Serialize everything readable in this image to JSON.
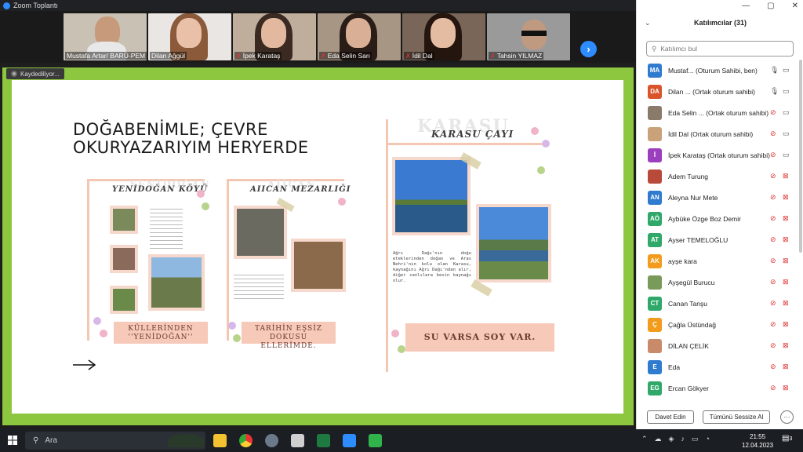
{
  "window": {
    "title": "Zoom Toplantı"
  },
  "participants_strip": [
    {
      "name": "Mustafa Artar/ BARÜ-PEM",
      "muted": false
    },
    {
      "name": "Dilan Ağgül",
      "muted": false
    },
    {
      "name": "İpek Karataş",
      "muted": true
    },
    {
      "name": "Eda Selin Sarı",
      "muted": true
    },
    {
      "name": "İdil Dal",
      "muted": true
    },
    {
      "name": "Tahsin YILMAZ",
      "muted": true
    }
  ],
  "recording": {
    "label": "Kaydediliyor..."
  },
  "slide": {
    "title_line1": "DOĞABENİMLE; ÇEVRE",
    "title_line2": "OKURYAZARIYIM HERYERDE",
    "sections": [
      {
        "ghost": "YENİDOĞAN",
        "title": "YENİDOĞAN KÖYÜ",
        "caption": "KÜLLERİNDEN ''YENİDOĞAN''"
      },
      {
        "ghost": "AİİCAN",
        "title": "AIICAN MEZARLIĞI",
        "caption": "TARİHİN EŞSİZ DOKUSU ELLERİMDE."
      },
      {
        "ghost": "KARASU",
        "title": "KARASU ÇAYI",
        "caption": "SU VARSA SOY VAR."
      }
    ],
    "karasu_text": "Ağrı Dağı'nın doğu eteklerinden doğan ve Aras Nehri'nin kolu olan Karasu, kaynağını Ağrı Dağı'ndan alır, diğer canlılara besin kaynağı olur."
  },
  "panel": {
    "title": "Katılımcılar (31)",
    "search_placeholder": "Katılımcı bul",
    "participants": [
      {
        "initials": "MA",
        "color": "#2e7bcf",
        "name": "Mustaf...  (Oturum Sahibi, ben)",
        "mic": "on",
        "cam": "off"
      },
      {
        "initials": "DA",
        "color": "#d9542b",
        "name": "Dilan ...  (Ortak oturum sahibi)",
        "mic": "on",
        "cam": "off"
      },
      {
        "initials": "",
        "color": "#8a7a6a",
        "name": "Eda Selin ...  (Ortak oturum sahibi)",
        "mic": "muted",
        "cam": "off"
      },
      {
        "initials": "",
        "color": "#c9a27a",
        "name": "İdil Dal  (Ortak oturum sahibi)",
        "mic": "muted",
        "cam": "off"
      },
      {
        "initials": "İ",
        "color": "#9b3fbf",
        "name": "İpek Karataş  (Ortak oturum sahibi)",
        "mic": "muted",
        "cam": "off"
      },
      {
        "initials": "",
        "color": "#b84a3a",
        "name": "Adem Turung",
        "mic": "muted",
        "cam": "muted"
      },
      {
        "initials": "AN",
        "color": "#2e7bcf",
        "name": "Aleyna Nur Mete",
        "mic": "muted",
        "cam": "muted"
      },
      {
        "initials": "AÖ",
        "color": "#2fa86a",
        "name": "Aybüke Özge Boz Demir",
        "mic": "muted",
        "cam": "muted"
      },
      {
        "initials": "AT",
        "color": "#2fa86a",
        "name": "Ayser TEMELOĞLU",
        "mic": "muted",
        "cam": "muted"
      },
      {
        "initials": "AK",
        "color": "#f29b1d",
        "name": "ayşe kara",
        "mic": "muted",
        "cam": "muted"
      },
      {
        "initials": "",
        "color": "#7a9a5a",
        "name": "Ayşegül Burucu",
        "mic": "muted",
        "cam": "muted"
      },
      {
        "initials": "CT",
        "color": "#2fa86a",
        "name": "Canan Tanşu",
        "mic": "muted",
        "cam": "muted"
      },
      {
        "initials": "Ç",
        "color": "#f29b1d",
        "name": "Çağla Üstündağ",
        "mic": "muted",
        "cam": "muted"
      },
      {
        "initials": "",
        "color": "#c98a6a",
        "name": "DİLAN ÇELİK",
        "mic": "muted",
        "cam": "muted"
      },
      {
        "initials": "E",
        "color": "#2e7bcf",
        "name": "Eda",
        "mic": "muted",
        "cam": "muted"
      },
      {
        "initials": "EG",
        "color": "#2fa86a",
        "name": "Ercan Gökyer",
        "mic": "muted",
        "cam": "muted"
      }
    ],
    "invite_label": "Davet Edin",
    "mute_all_label": "Tümünü Sessize Al",
    "more_label": "···"
  },
  "taskbar": {
    "search_placeholder": "Ara",
    "time": "21:55",
    "date": "12.04.2023",
    "notifications": "3"
  }
}
